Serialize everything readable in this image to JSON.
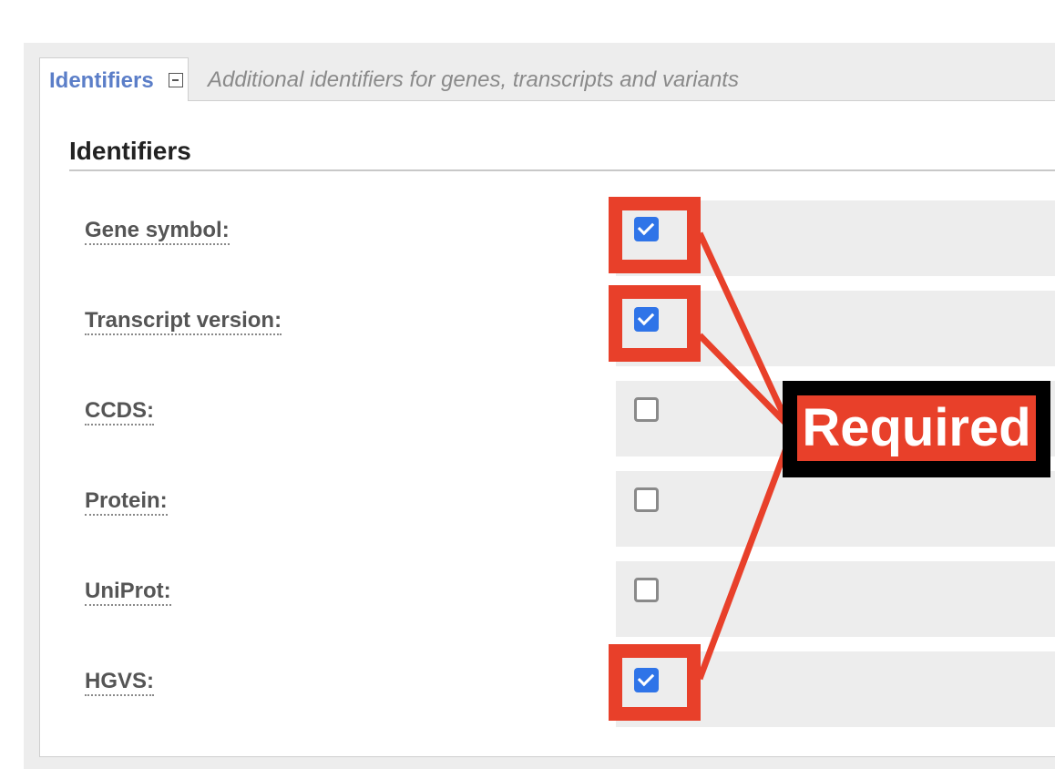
{
  "tab": {
    "label": "Identifiers",
    "description": "Additional identifiers for genes, transcripts and variants"
  },
  "section": {
    "title": "Identifiers"
  },
  "rows": [
    {
      "label": "Gene symbol:",
      "checked": true
    },
    {
      "label": "Transcript version:",
      "checked": true
    },
    {
      "label": "CCDS:",
      "checked": false
    },
    {
      "label": "Protein:",
      "checked": false
    },
    {
      "label": "UniProt:",
      "checked": false
    },
    {
      "label": "HGVS:",
      "checked": true
    }
  ],
  "annotation": {
    "text": "Required",
    "color": "#e8402a"
  },
  "colors": {
    "tab_label": "#5b7ec8",
    "checkbox_checked": "#2f74e8",
    "row_background": "#ededed"
  }
}
